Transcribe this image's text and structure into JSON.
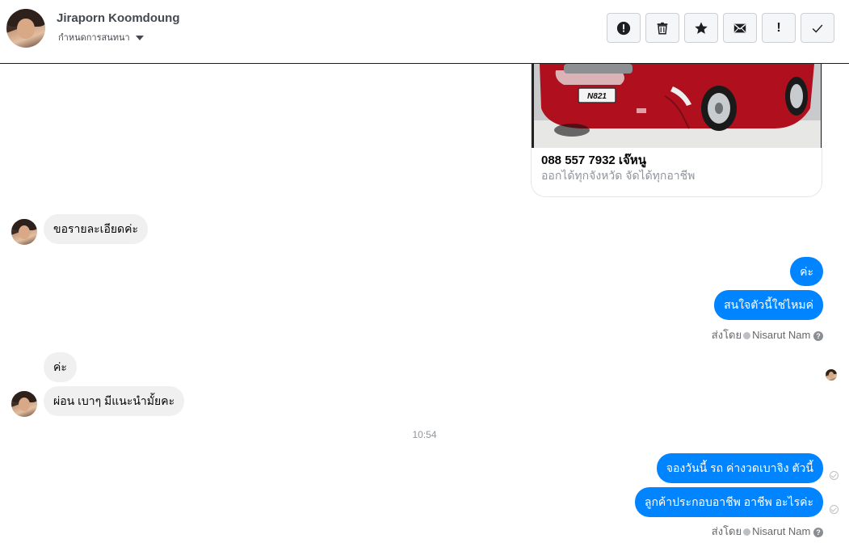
{
  "header": {
    "contact_name": "Jiraporn Koomdoung",
    "subtitle": "กำหนดการสนทนา",
    "toolbar": [
      {
        "icon": "alert-circle-icon"
      },
      {
        "icon": "trash-icon"
      },
      {
        "icon": "star-icon"
      },
      {
        "icon": "envelope-icon"
      },
      {
        "icon": "exclamation-icon",
        "label": "!"
      },
      {
        "icon": "checkmark-icon"
      }
    ]
  },
  "card": {
    "plate": "N821",
    "title": "088 557 7932 เจ๊หนู",
    "description": "ออกได้ทุกจังหวัด จัดได้ทุกอาชีพ"
  },
  "messages": {
    "in1": "ขอรายละเอียดค่ะ",
    "out1": "ค่ะ",
    "out2": "สนใจตัวนี้ใช่ไหมค่",
    "in2": "ค่ะ",
    "in3": "ผ่อน เบาๆ  มีแนะนำมั้ยคะ",
    "out3": "จองวันนี้ รถ ค่างวดเบาจิง ตัวนี้",
    "out4": "ลูกค้าประกอบอาชีพ อาชีพ อะไรค่ะ"
  },
  "sent_by": {
    "prefix": "ส่งโดย",
    "name": "Nisarut Nam",
    "help": "?"
  },
  "timestamp": "10:54",
  "colors": {
    "outgoing": "#0084ff",
    "incoming": "#f0f0f0"
  }
}
